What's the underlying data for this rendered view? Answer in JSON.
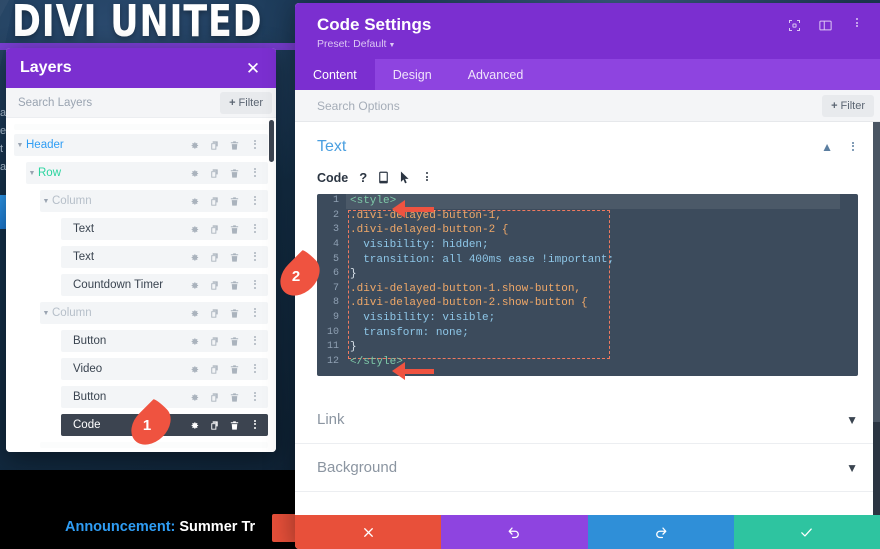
{
  "site": {
    "title": "DIVI UNITED",
    "side_text": "a\ne\nt\na",
    "announcement_label": "Announcement:",
    "announcement_text": "Summer Tr",
    "colors": {
      "purple_strip": "#7b3fd4",
      "accent_blue": "#2f9df4"
    }
  },
  "layers_panel": {
    "title": "Layers",
    "close_icon": "close-icon",
    "search_placeholder": "Search Layers",
    "search_value": "",
    "filter_label": "Filter",
    "rows": [
      {
        "name": "Header",
        "kind": "header",
        "indent": 0,
        "caret": true,
        "selected": false
      },
      {
        "name": "Row",
        "kind": "row",
        "indent": 1,
        "caret": true,
        "selected": false
      },
      {
        "name": "Column",
        "kind": "column",
        "indent": 2,
        "caret": true,
        "selected": false
      },
      {
        "name": "Text",
        "kind": "module",
        "indent": 3,
        "caret": false,
        "selected": false
      },
      {
        "name": "Text",
        "kind": "module",
        "indent": 3,
        "caret": false,
        "selected": false
      },
      {
        "name": "Countdown Timer",
        "kind": "module",
        "indent": 3,
        "caret": false,
        "selected": false
      },
      {
        "name": "Column",
        "kind": "column",
        "indent": 2,
        "caret": true,
        "selected": false
      },
      {
        "name": "Button",
        "kind": "module",
        "indent": 3,
        "caret": false,
        "selected": false
      },
      {
        "name": "Video",
        "kind": "module",
        "indent": 3,
        "caret": false,
        "selected": false
      },
      {
        "name": "Button",
        "kind": "module",
        "indent": 3,
        "caret": false,
        "selected": false
      },
      {
        "name": "Code",
        "kind": "module",
        "indent": 3,
        "caret": false,
        "selected": true
      }
    ],
    "row_icons": [
      "gear-icon",
      "duplicate-icon",
      "trash-icon",
      "more-options-icon"
    ]
  },
  "settings": {
    "title": "Code Settings",
    "preset": "Preset: Default",
    "header_icons": [
      "focus-icon",
      "layout-panel-icon",
      "more-options-icon"
    ],
    "tabs": [
      {
        "label": "Content",
        "active": true
      },
      {
        "label": "Design",
        "active": false
      },
      {
        "label": "Advanced",
        "active": false
      }
    ],
    "search_placeholder": "Search Options",
    "search_value": "",
    "filter_label": "Filter",
    "text_section": {
      "title": "Text",
      "collapse_icon": "chevron-up-icon",
      "more_icon": "more-options-icon",
      "code_label": "Code",
      "code_toolbar_icons": [
        "help-icon",
        "responsive-icon",
        "hover-icon",
        "more-options-icon"
      ]
    },
    "code_lines": [
      {
        "n": 1,
        "text": "<style>"
      },
      {
        "n": 2,
        "text": ".divi-delayed-button-1,"
      },
      {
        "n": 3,
        "text": ".divi-delayed-button-2 {"
      },
      {
        "n": 4,
        "text": "  visibility: hidden;"
      },
      {
        "n": 5,
        "text": "  transition: all 400ms ease !important;"
      },
      {
        "n": 6,
        "text": "}"
      },
      {
        "n": 7,
        "text": ".divi-delayed-button-1.show-button,"
      },
      {
        "n": 8,
        "text": ".divi-delayed-button-2.show-button {"
      },
      {
        "n": 9,
        "text": "  visibility: visible;"
      },
      {
        "n": 10,
        "text": "  transform: none;"
      },
      {
        "n": 11,
        "text": "}"
      },
      {
        "n": 12,
        "text": "</style>"
      }
    ],
    "accordions": [
      {
        "label": "Link",
        "chevron": "chevron-down-icon"
      },
      {
        "label": "Background",
        "chevron": "chevron-down-icon"
      }
    ],
    "footer_buttons": [
      {
        "name": "cancel",
        "icon": "close-icon",
        "color": "#e8503a"
      },
      {
        "name": "undo",
        "icon": "undo-icon",
        "color": "#8e44e0"
      },
      {
        "name": "redo",
        "icon": "redo-icon",
        "color": "#2f8fd8"
      },
      {
        "name": "save",
        "icon": "check-icon",
        "color": "#2ec4a0"
      }
    ]
  },
  "markers": [
    {
      "number": "1",
      "target": "code-layer-gear-icon"
    },
    {
      "number": "2",
      "target": "code-editor-block"
    }
  ]
}
